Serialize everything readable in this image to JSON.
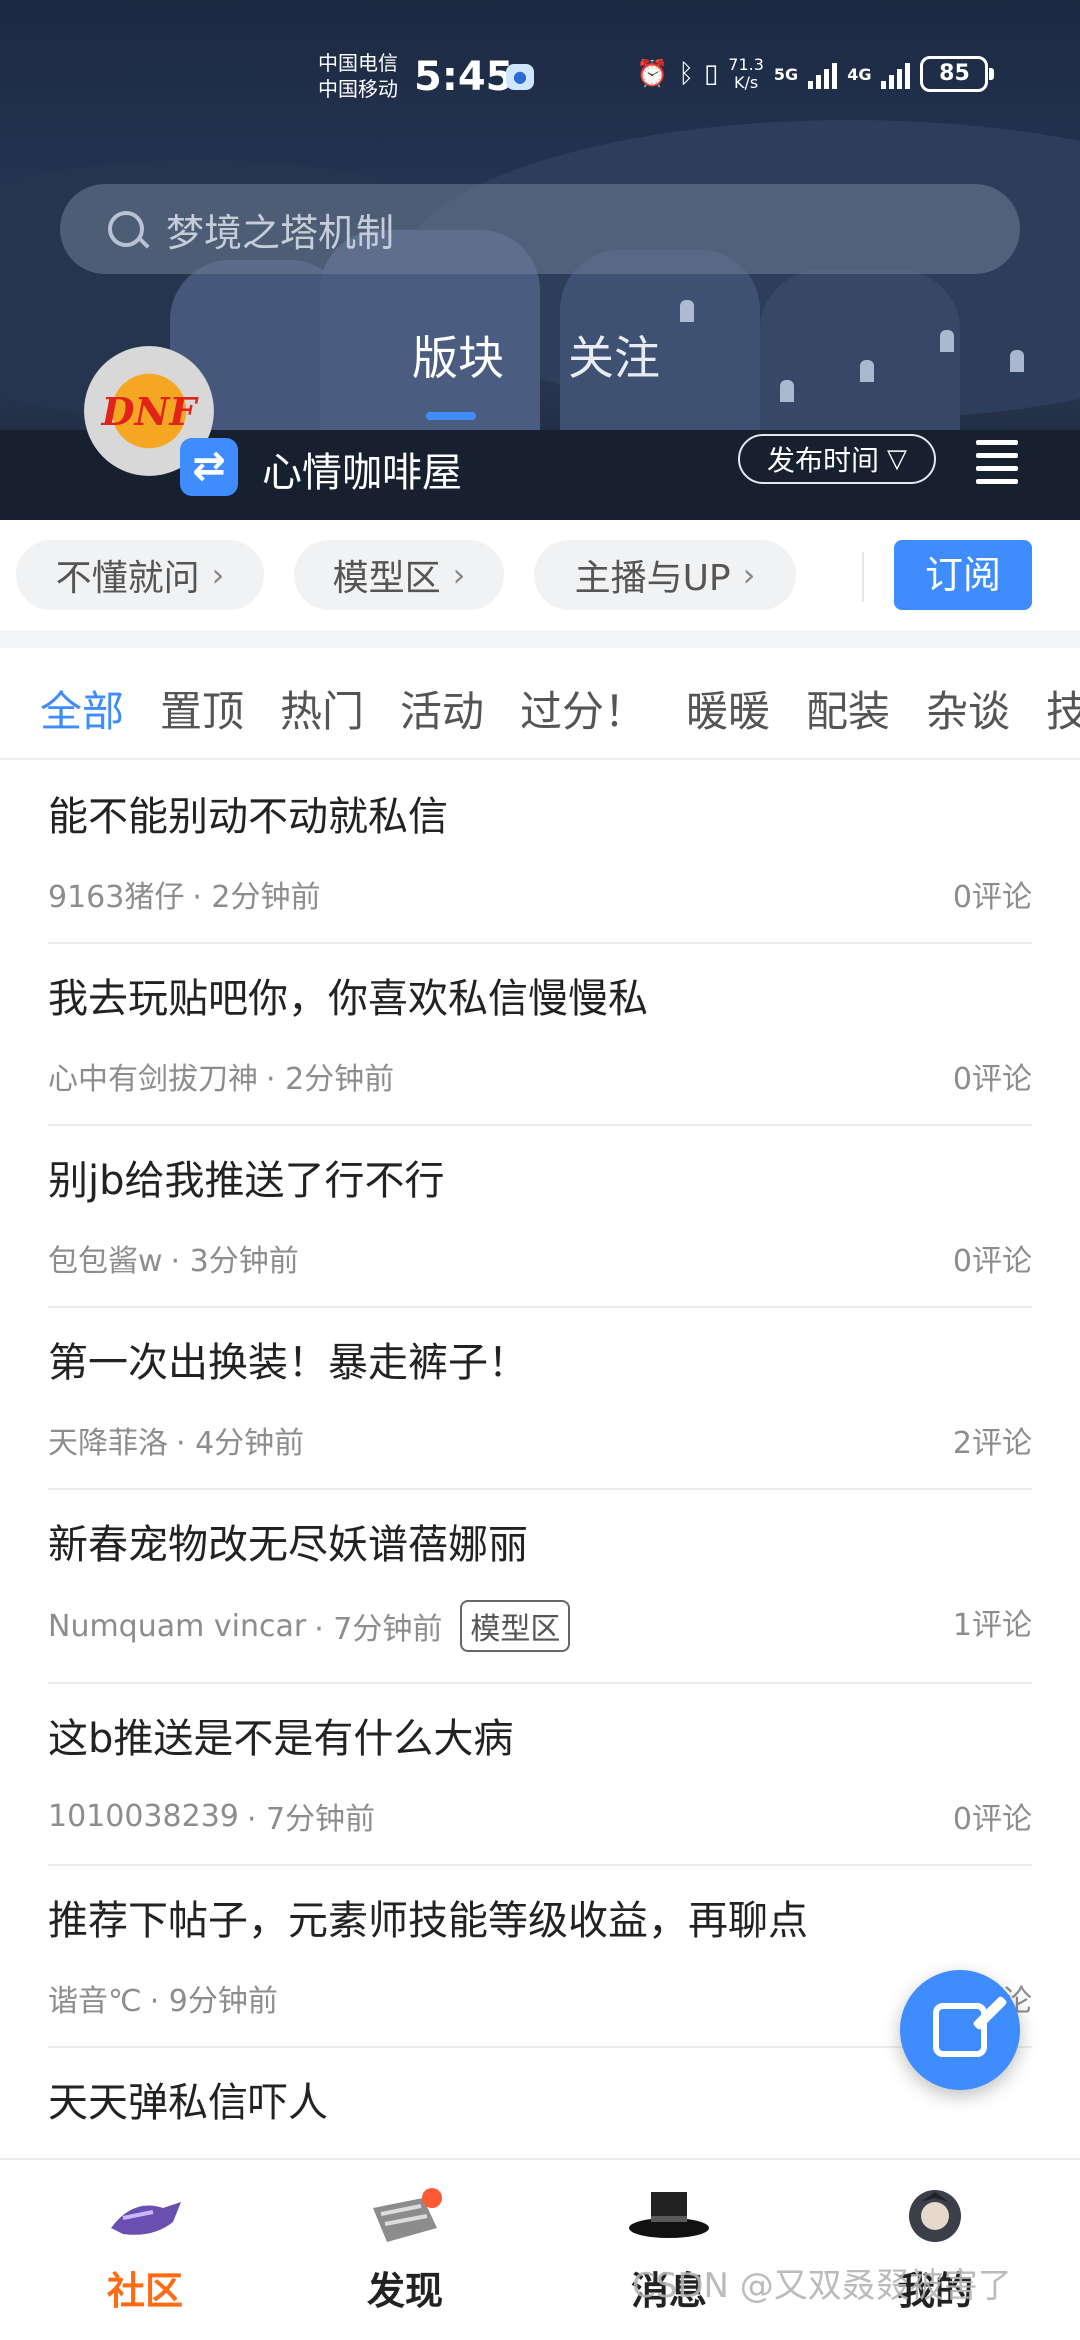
{
  "status_bar": {
    "carrier_1": "中国电信",
    "carrier_2": "中国移动",
    "time": "5:45",
    "net_speed_value": "71.3",
    "net_speed_unit": "K/s",
    "net_5g": "5G",
    "net_4g": "4G",
    "battery": "85"
  },
  "search": {
    "placeholder": "梦境之塔机制"
  },
  "top_tabs": {
    "board": "版块",
    "follow": "关注"
  },
  "forum": {
    "logo_text": "DNF",
    "name": "心情咖啡屋",
    "sort_label": "发布时间"
  },
  "chips": [
    {
      "label": "不懂就问"
    },
    {
      "label": "模型区"
    },
    {
      "label": "主播与UP"
    }
  ],
  "subscribe_label": "订阅",
  "filters": [
    {
      "label": "全部"
    },
    {
      "label": "置顶"
    },
    {
      "label": "热门"
    },
    {
      "label": "活动"
    },
    {
      "label": "过分！"
    },
    {
      "label": "暖暖"
    },
    {
      "label": "配装"
    },
    {
      "label": "杂谈"
    },
    {
      "label": "技"
    }
  ],
  "posts": [
    {
      "title": "能不能别动不动就私信",
      "author": "9163猪仔",
      "time": "· 2分钟前",
      "tag": "",
      "comments": "0评论"
    },
    {
      "title": "我去玩贴吧你，你喜欢私信慢慢私",
      "author": "心中有剑拔刀神",
      "time": "· 2分钟前",
      "tag": "",
      "comments": "0评论"
    },
    {
      "title": "别jb给我推送了行不行",
      "author": "包包酱w",
      "time": "· 3分钟前",
      "tag": "",
      "comments": "0评论"
    },
    {
      "title": "第一次出换装！暴走裤子！",
      "author": "天降菲洛",
      "time": "· 4分钟前",
      "tag": "",
      "comments": "2评论"
    },
    {
      "title": "新春宠物改无尽妖谱蓓娜丽",
      "author": "Numquam vincar",
      "time": "· 7分钟前",
      "tag": "模型区",
      "comments": "1评论"
    },
    {
      "title": "这b推送是不是有什么大病",
      "author": "1010038239",
      "time": "· 7分钟前",
      "tag": "",
      "comments": "0评论"
    },
    {
      "title": "推荐下帖子，元素师技能等级收益，再聊点",
      "author": "谐音℃",
      "time": "· 9分钟前",
      "tag": "",
      "comments": "评论"
    },
    {
      "title": "天天弹私信吓人",
      "author": "",
      "time": "",
      "tag": "",
      "comments": ""
    }
  ],
  "bottom_nav": {
    "community": "社区",
    "discover": "发现",
    "messages": "消息",
    "mine": "我的"
  },
  "watermark": "CSDN @又双叒叕被害了",
  "colors": {
    "accent": "#3f8cff",
    "active_nav": "#ff6a13",
    "badge_dot": "#ff5a36"
  }
}
